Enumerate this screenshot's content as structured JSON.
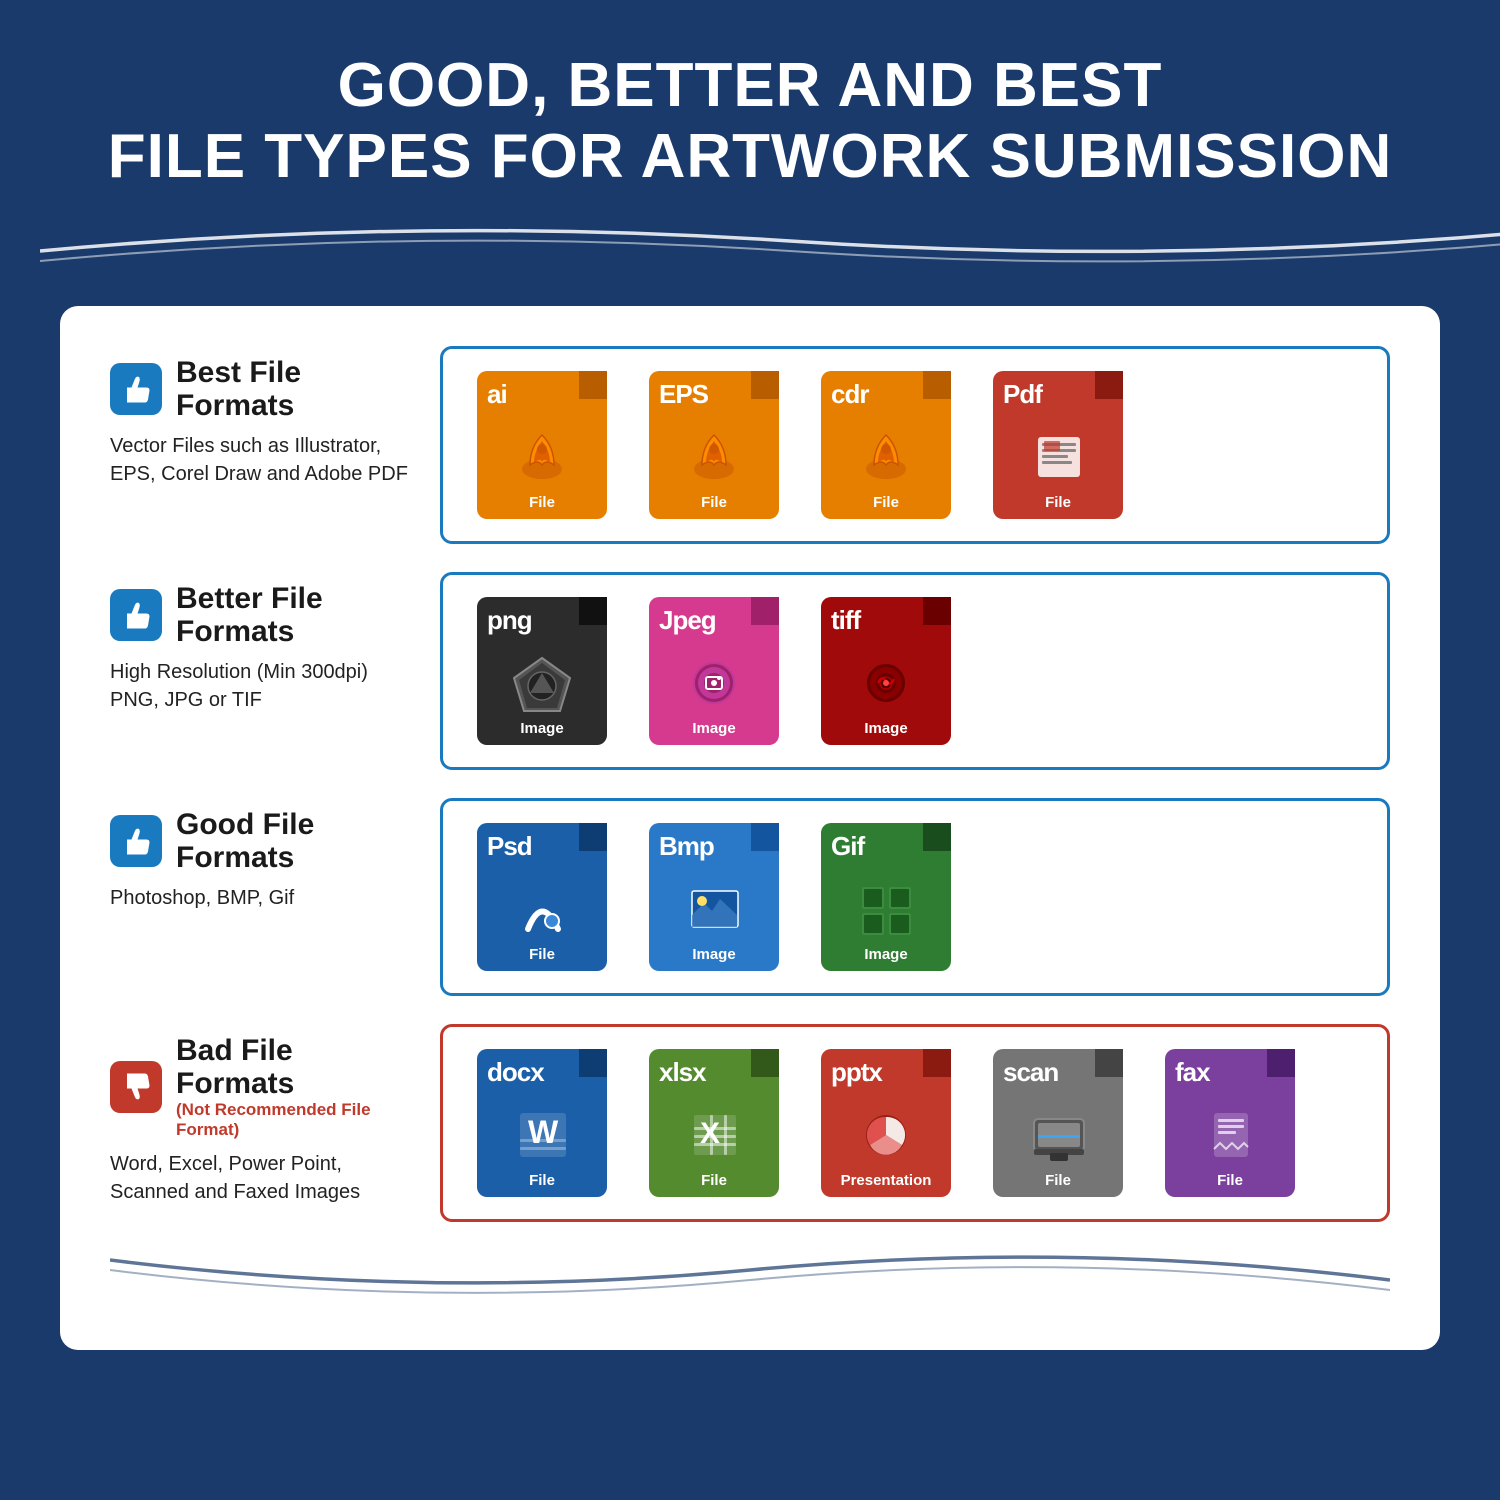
{
  "header": {
    "line1": "GOOD, BETTER AND BEST",
    "line2": "FILE TYPES FOR ARTWORK SUBMISSION"
  },
  "sections": [
    {
      "id": "best",
      "thumbs": "up",
      "title": "Best File Formats",
      "subtitle": null,
      "desc": "Vector Files such as Illustrator,\nEPS, Corel Draw and Adobe PDF",
      "borderColor": "blue",
      "files": [
        {
          "ext": "ai",
          "color": "orange",
          "label": "File",
          "icon": "ai"
        },
        {
          "ext": "EPS",
          "color": "orange",
          "label": "File",
          "icon": "eps"
        },
        {
          "ext": "cdr",
          "color": "orange",
          "label": "File",
          "icon": "cdr"
        },
        {
          "ext": "Pdf",
          "color": "red",
          "label": "File",
          "icon": "pdf"
        }
      ]
    },
    {
      "id": "better",
      "thumbs": "up",
      "title": "Better File Formats",
      "subtitle": null,
      "desc": "High Resolution (Min 300dpi)\nPNG, JPG or TIF",
      "borderColor": "blue",
      "files": [
        {
          "ext": "png",
          "color": "dark",
          "label": "Image",
          "icon": "png"
        },
        {
          "ext": "Jpeg",
          "color": "pink",
          "label": "Image",
          "icon": "jpeg"
        },
        {
          "ext": "tiff",
          "color": "darkred",
          "label": "Image",
          "icon": "tiff"
        }
      ]
    },
    {
      "id": "good",
      "thumbs": "up",
      "title": "Good File Formats",
      "subtitle": null,
      "desc": "Photoshop, BMP, Gif",
      "borderColor": "blue",
      "files": [
        {
          "ext": "Psd",
          "color": "blue",
          "label": "File",
          "icon": "psd"
        },
        {
          "ext": "Bmp",
          "color": "lightblue",
          "label": "Image",
          "icon": "bmp"
        },
        {
          "ext": "Gif",
          "color": "green",
          "label": "Image",
          "icon": "gif"
        }
      ]
    },
    {
      "id": "bad",
      "thumbs": "down",
      "title": "Bad File Formats",
      "subtitle": "(Not Recommended File Format)",
      "desc": "Word, Excel, Power Point,\nScanned and Faxed Images",
      "borderColor": "red",
      "files": [
        {
          "ext": "docx",
          "color": "blue",
          "label": "File",
          "icon": "docx"
        },
        {
          "ext": "xlsx",
          "color": "olive",
          "label": "File",
          "icon": "xlsx"
        },
        {
          "ext": "pptx",
          "color": "red",
          "label": "Presentation",
          "icon": "pptx"
        },
        {
          "ext": "scan",
          "color": "grey",
          "label": "File",
          "icon": "scan"
        },
        {
          "ext": "fax",
          "color": "purple",
          "label": "File",
          "icon": "fax"
        }
      ]
    }
  ]
}
